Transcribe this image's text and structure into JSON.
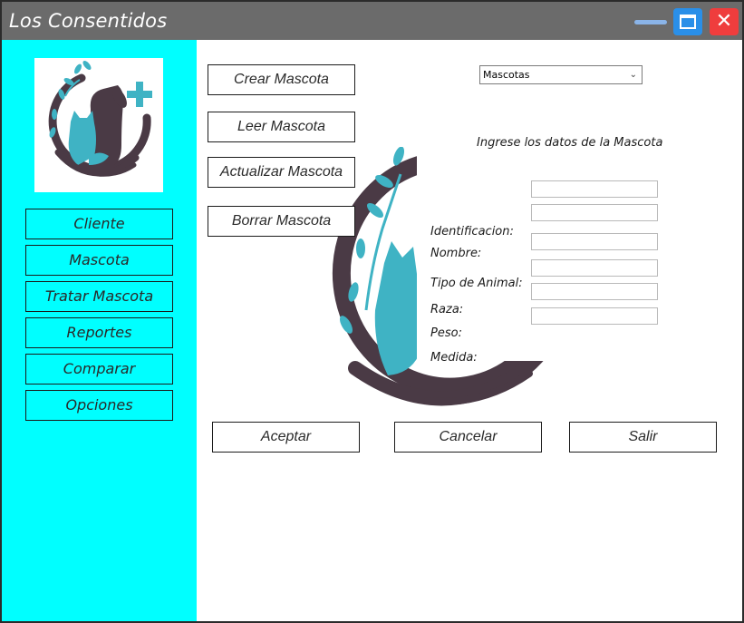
{
  "window": {
    "title": "Los Consentidos"
  },
  "sidebar": {
    "items": [
      {
        "label": "Cliente"
      },
      {
        "label": "Mascota"
      },
      {
        "label": "Tratar Mascota"
      },
      {
        "label": "Reportes"
      },
      {
        "label": "Comparar"
      },
      {
        "label": "Opciones"
      }
    ]
  },
  "actions": {
    "crear": "Crear Mascota",
    "leer": "Leer Mascota",
    "actualizar": "Actualizar Mascota",
    "borrar": "Borrar Mascota"
  },
  "selector": {
    "value": "Mascotas"
  },
  "form": {
    "title": "Ingrese los datos de la Mascota",
    "fields": [
      {
        "label": "Identificacion:",
        "value": ""
      },
      {
        "label": "Nombre:",
        "value": ""
      },
      {
        "label": "Tipo de Animal:",
        "value": ""
      },
      {
        "label": "Raza:",
        "value": ""
      },
      {
        "label": "Peso:",
        "value": ""
      },
      {
        "label": "Medida:",
        "value": ""
      }
    ]
  },
  "buttons": {
    "aceptar": "Aceptar",
    "cancelar": "Cancelar",
    "salir": "Salir"
  },
  "colors": {
    "sidebar": "#00ffff",
    "titlebar": "#6b6b6b",
    "logo_dark": "#4a3a45",
    "logo_teal": "#3fb3c4"
  }
}
